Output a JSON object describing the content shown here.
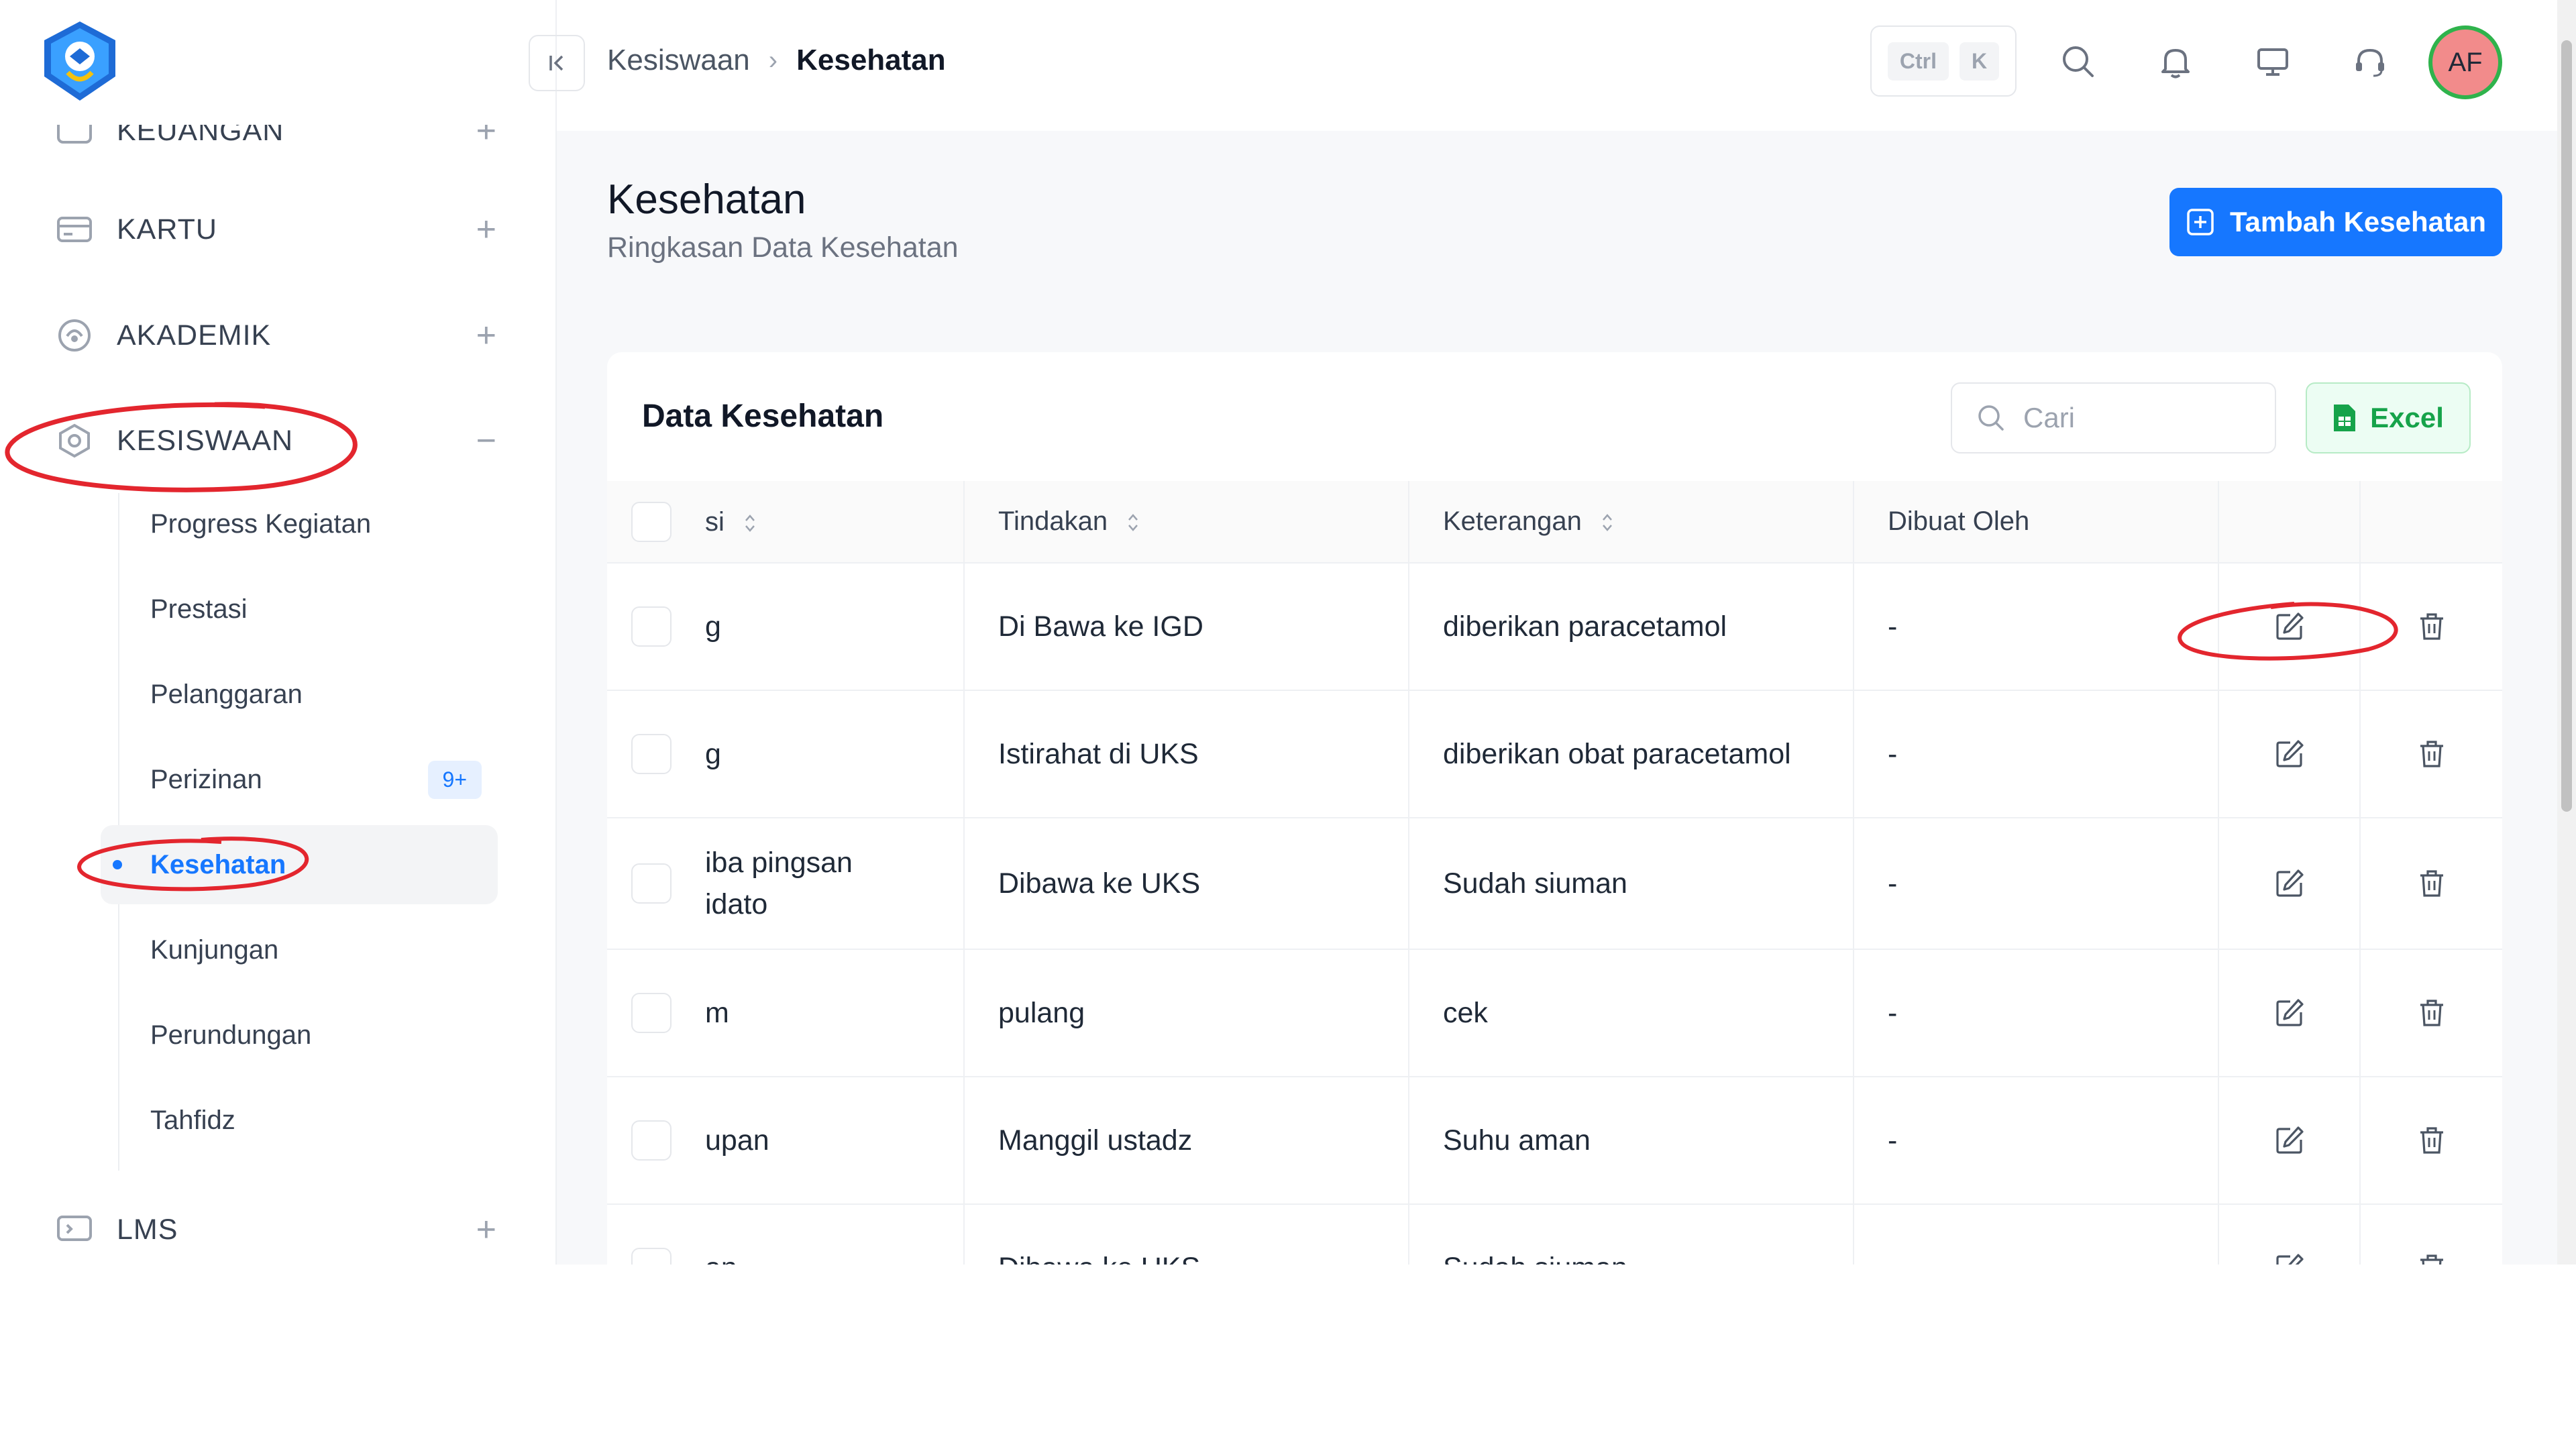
{
  "sidebar": {
    "groups": [
      {
        "label": "KEUANGAN",
        "icon": "wallet-icon",
        "toggle": "+"
      },
      {
        "label": "KARTU",
        "icon": "card-icon",
        "toggle": "+"
      },
      {
        "label": "AKADEMIK",
        "icon": "academic-icon",
        "toggle": "+"
      },
      {
        "label": "KESISWAAN",
        "icon": "student-icon",
        "toggle": "−"
      },
      {
        "label": "LMS",
        "icon": "lms-icon",
        "toggle": "+"
      }
    ],
    "sub_items": [
      {
        "label": "Progress Kegiatan"
      },
      {
        "label": "Prestasi"
      },
      {
        "label": "Pelanggaran"
      },
      {
        "label": "Perizinan",
        "badge": "9+"
      },
      {
        "label": "Kesehatan",
        "active": true
      },
      {
        "label": "Kunjungan"
      },
      {
        "label": "Perundungan"
      },
      {
        "label": "Tahfidz"
      }
    ]
  },
  "header": {
    "breadcrumb_parent": "Kesiswaan",
    "breadcrumb_sep": "›",
    "breadcrumb_current": "Kesehatan",
    "kbd_ctrl": "Ctrl",
    "kbd_key": "K",
    "avatar_initials": "AF",
    "icons": [
      "search-icon",
      "bell-icon",
      "monitor-icon",
      "headset-icon"
    ]
  },
  "main": {
    "title": "Kesehatan",
    "subtitle": "Ringkasan Data Kesehatan",
    "add_button": "Tambah Kesehatan",
    "card_title": "Data Kesehatan",
    "search_placeholder": "Cari",
    "excel_button": "Excel",
    "columns": [
      "si",
      "Tindakan",
      "Keterangan",
      "Dibuat Oleh"
    ],
    "rows": [
      {
        "kondisi": "g",
        "tindakan": "Di Bawa ke IGD",
        "keterangan": "diberikan paracetamol",
        "dibuat_oleh": "-"
      },
      {
        "kondisi": "g",
        "tindakan": "Istirahat di UKS",
        "keterangan": "diberikan obat paracetamol",
        "dibuat_oleh": "-"
      },
      {
        "kondisi": "iba pingsan idato",
        "tindakan": "Dibawa ke UKS",
        "keterangan": "Sudah siuman",
        "dibuat_oleh": "-"
      },
      {
        "kondisi": "m",
        "tindakan": "pulang",
        "keterangan": "cek",
        "dibuat_oleh": "-"
      },
      {
        "kondisi": "upan",
        "tindakan": "Manggil ustadz",
        "keterangan": "Suhu aman",
        "dibuat_oleh": "-"
      },
      {
        "kondisi": "an",
        "tindakan": "Dibawa ke UKS",
        "keterangan": "Sudah siuman",
        "dibuat_oleh": "-"
      }
    ]
  },
  "colors": {
    "accent": "#1677ff",
    "excel_green": "#16a34a",
    "annotation_red": "#e3262e",
    "avatar_bg": "#f28b8b",
    "avatar_ring": "#2fb34c"
  }
}
